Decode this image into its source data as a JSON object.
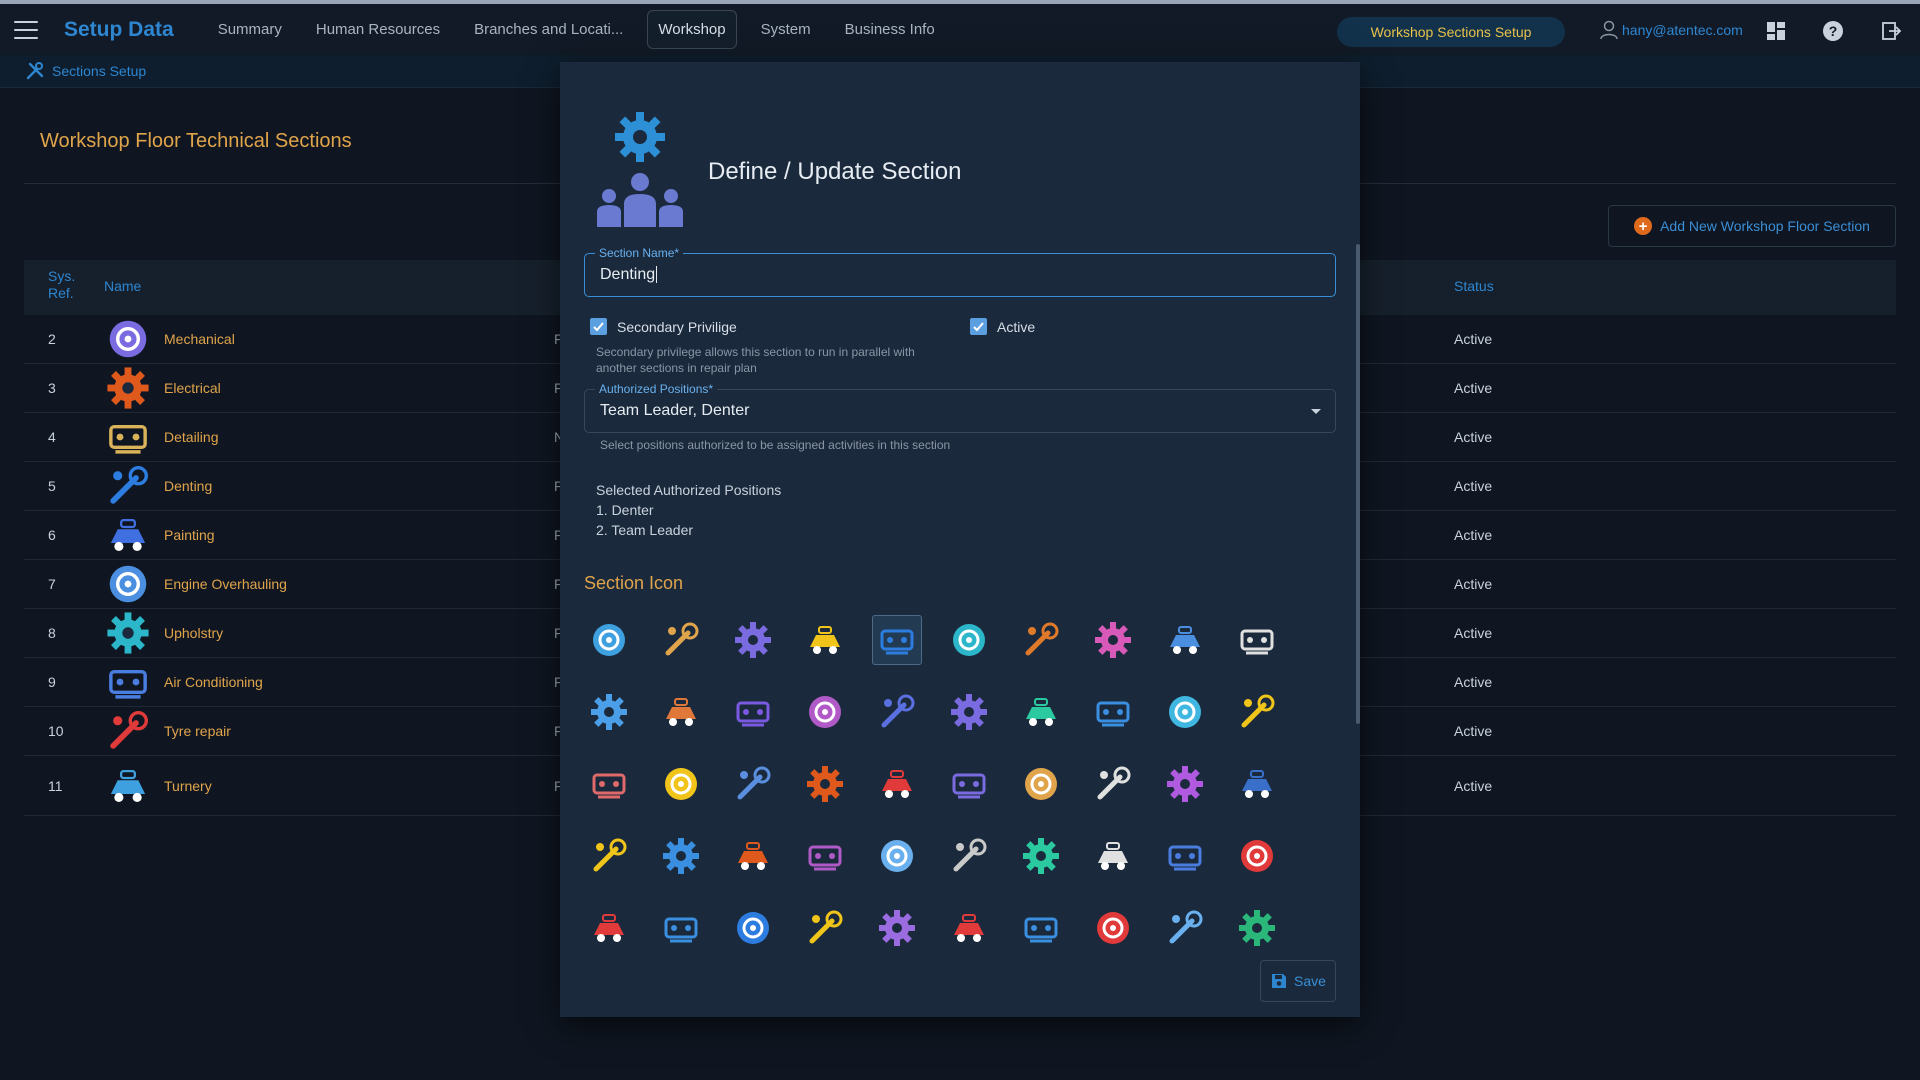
{
  "app": {
    "brand": "Setup Data",
    "nav": [
      {
        "label": "Summary"
      },
      {
        "label": "Human Resources"
      },
      {
        "label": "Branches and Locati..."
      },
      {
        "label": "Workshop"
      },
      {
        "label": "System"
      },
      {
        "label": "Business Info"
      }
    ],
    "active_pill": "Workshop Sections Setup",
    "user_email": "hany@atentec.com"
  },
  "subbar": {
    "label": "Sections Setup"
  },
  "page": {
    "title": "Workshop Floor Technical Sections",
    "add_button": "Add New Workshop Floor Section"
  },
  "table": {
    "headers": {
      "ref_line1": "Sys.",
      "ref_line2": "Ref.",
      "name": "Name",
      "status": "Status"
    },
    "rows": [
      {
        "ref": "2",
        "name": "Mechanical",
        "cut": "F",
        "status": "Active",
        "icon": "mechanical-icon",
        "color": "#7a6ce0"
      },
      {
        "ref": "3",
        "name": "Electrical",
        "cut": "F",
        "status": "Active",
        "icon": "electrical-icon",
        "color": "#e0591c"
      },
      {
        "ref": "4",
        "name": "Detailing",
        "cut": "N",
        "status": "Active",
        "icon": "detailing-icon",
        "color": "#d9b25a"
      },
      {
        "ref": "5",
        "name": "Denting",
        "cut": "F",
        "status": "Active",
        "icon": "denting-icon",
        "color": "#2d7de0"
      },
      {
        "ref": "6",
        "name": "Painting",
        "cut": "F",
        "status": "Active",
        "icon": "painting-icon",
        "color": "#3f6fe0"
      },
      {
        "ref": "7",
        "name": "Engine Overhauling",
        "cut": "F",
        "status": "Active",
        "icon": "engine-icon",
        "color": "#4a8fe0"
      },
      {
        "ref": "8",
        "name": "Upholstry",
        "cut": "F",
        "status": "Active",
        "icon": "upholstry-icon",
        "color": "#2bb7c9"
      },
      {
        "ref": "9",
        "name": "Air Conditioning",
        "cut": "F",
        "status": "Active",
        "icon": "ac-icon",
        "color": "#4a7de0"
      },
      {
        "ref": "10",
        "name": "Tyre repair",
        "cut": "F",
        "status": "Active",
        "icon": "tyre-icon",
        "color": "#e03a3a"
      },
      {
        "ref": "11",
        "name": "Turnery",
        "cut": "F",
        "status": "Active",
        "icon": "turnery-icon",
        "color": "#3fa0e0"
      }
    ]
  },
  "modal": {
    "title": "Define / Update Section",
    "section_name_label": "Section Name*",
    "section_name_value": "Denting",
    "secondary_label": "Secondary Privilige",
    "secondary_hint_1": "Secondary privilege allows this section to run in parallel with",
    "secondary_hint_2": "another sections in repair plan",
    "active_label": "Active",
    "positions_label": "Authorized Positions*",
    "positions_value": "Team Leader, Denter",
    "positions_hint": "Select positions authorized to be assigned activities in this section",
    "selected_title": "Selected Authorized Positions",
    "selected_items": [
      "1. Denter",
      "2. Team Leader"
    ],
    "icon_section_title": "Section Icon",
    "save_label": "Save"
  },
  "icon_grid": {
    "selected_index": 4,
    "colors": [
      "#3fa0e0",
      "#e0a44b",
      "#7a6ce0",
      "#f0c419",
      "#2d7de0",
      "#2bb7c9",
      "#e07a2a",
      "#d85ab8",
      "#4a8fe0",
      "#e0e0e0",
      "#4a9fe8",
      "#e0783a",
      "#7a5ae0",
      "#b05ac8",
      "#5a70e0",
      "#7a6ce0",
      "#2bc9a0",
      "#3a8fe0",
      "#3fb7e0",
      "#f0c419",
      "#e06a6a",
      "#f0c419",
      "#5a8fe0",
      "#e0591c",
      "#e03a3a",
      "#7a6ce0",
      "#e0a44b",
      "#e0e0e0",
      "#b05ae0",
      "#3a6fc9",
      "#f0c419",
      "#3a8fe0",
      "#e0591c",
      "#b05ac8",
      "#6ab0ee",
      "#c9c9c9",
      "#2bc9a0",
      "#e0e0e0",
      "#4a7de0",
      "#e03a3a",
      "#e03a3a",
      "#3a8fe0",
      "#2d7de0",
      "#f0c419",
      "#9a6ce0",
      "#e03a3a",
      "#3a8fe0",
      "#e03a3a",
      "#6ab0ee",
      "#2bb77a"
    ],
    "icons": [
      "gear-chain-icon",
      "diagnostic-icon",
      "engine-gear-icon",
      "gears-icon",
      "denting-hammer-icon",
      "drone-icon",
      "gears-colored-icon",
      "tools-cross-icon",
      "wrench-gear-icon",
      "steering-wheel-icon",
      "spinning-gear-icon",
      "brake-disc-icon",
      "gear-circuit-icon",
      "tools-icon",
      "robot-arm-icon",
      "hand-wrench-icon",
      "wheel-gear-icon",
      "puzzle-gear-icon",
      "target-gear-icon",
      "settings-gear-icon",
      "mechanic-icon",
      "lightning-icon",
      "technician-icon",
      "electric-plug-icon",
      "plugs-icon",
      "hand-bulb-icon",
      "panel-icon",
      "warning-sign-icon",
      "plug-circle-icon",
      "hand-gear-icon",
      "socket-icon",
      "charging-icon",
      "battery-plug-icon",
      "bulb-hand-icon",
      "fan-tool-icon",
      "no-spray-icon",
      "ac-unit-icon",
      "ac-hand-icon",
      "ac-monitor-icon",
      "ac-cross-icon",
      "vent-icon",
      "fan-disc-icon",
      "radiator-icon",
      "gear-dial-icon",
      "cog-circle-icon",
      "car-lift-icon",
      "car-wash-icon",
      "car-front-icon",
      "spray-car-icon",
      "car-service-icon"
    ]
  }
}
